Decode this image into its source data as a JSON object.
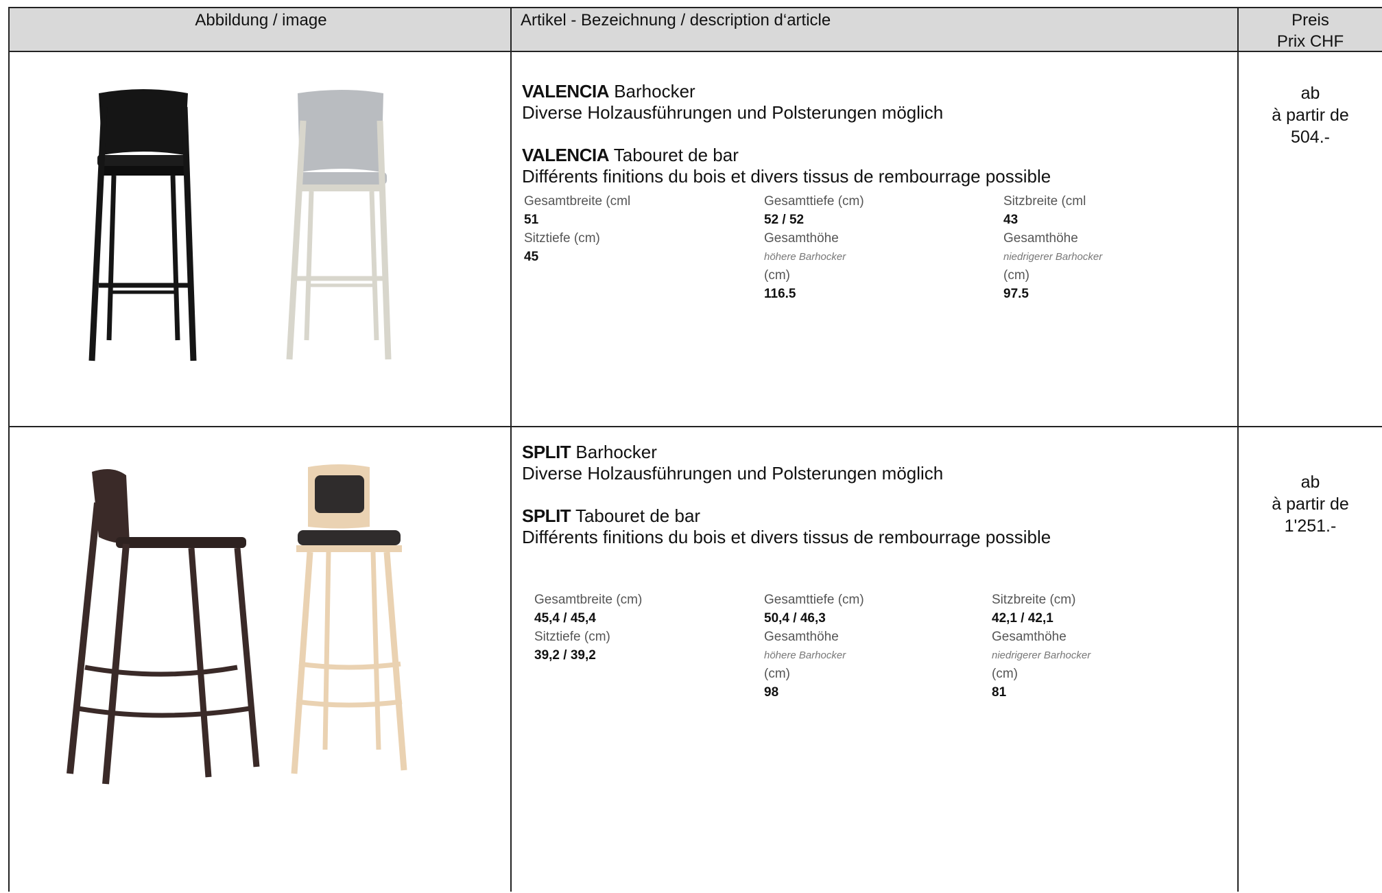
{
  "header": {
    "col_image": "Abbildung / image",
    "col_description": "Artikel - Bezeichnung / description d‘article",
    "col_price_line1": "Preis",
    "col_price_line2": "Prix CHF"
  },
  "products": [
    {
      "name": "VALENCIA",
      "type_de": "Barhocker",
      "text_de": "Diverse Holzausführungen und Polsterungen möglich",
      "type_fr": "Tabouret de bar",
      "text_fr": "Différents finitions du bois et divers tissus de rembourrage possible",
      "specs": {
        "width_label": "Gesamtbreite (cml",
        "width_value": "51",
        "depth_label": "Gesamttiefe (cm)",
        "depth_value": "52 / 52",
        "seat_width_label": "Sitzbreite (cml",
        "seat_width_value": "43",
        "seat_depth_label": "Sitztiefe (cm)",
        "seat_depth_value": "45",
        "height_high_label": "Gesamthöhe",
        "height_high_sub": "höhere Barhocker",
        "height_high_unit": "(cm)",
        "height_high_value": "116.5",
        "height_low_label": "Gesamthöhe",
        "height_low_sub": "niedrigerer Barhocker",
        "height_low_unit": "(cm)",
        "height_low_value": "97.5"
      },
      "price_line1": "ab",
      "price_line2": "à partir de",
      "price_value": "504.-",
      "colors": {
        "stool_a": "#151515",
        "stool_b_frame": "#d8d6cc",
        "stool_b_upholstery": "#b9bcc0"
      }
    },
    {
      "name": "SPLIT",
      "type_de": "Barhocker",
      "text_de": "Diverse Holzausführungen und Polsterungen möglich",
      "type_fr": "Tabouret de bar",
      "text_fr": "Différents finitions du bois et divers tissus de rembourrage possible",
      "specs": {
        "width_label": "Gesamtbreite (cm)",
        "width_value": "45,4 / 45,4",
        "depth_label": "Gesamttiefe (cm)",
        "depth_value": "50,4 / 46,3",
        "seat_width_label": "Sitzbreite (cm)",
        "seat_width_value": "42,1 / 42,1",
        "seat_depth_label": "Sitztiefe (cm)",
        "seat_depth_value": "39,2 / 39,2",
        "height_high_label": "Gesamthöhe",
        "height_high_sub": "höhere Barhocker",
        "height_high_unit": "(cm)",
        "height_high_value": "98",
        "height_low_label": "Gesamthöhe",
        "height_low_sub": "niedrigerer Barhocker",
        "height_low_unit": "(cm)",
        "height_low_value": "81"
      },
      "price_line1": "ab",
      "price_line2": "à partir de",
      "price_value": "1'251.-",
      "colors": {
        "stool_a": "#3a2a28",
        "stool_b_frame": "#ead2b2",
        "stool_b_upholstery": "#2f2c2c"
      }
    }
  ]
}
